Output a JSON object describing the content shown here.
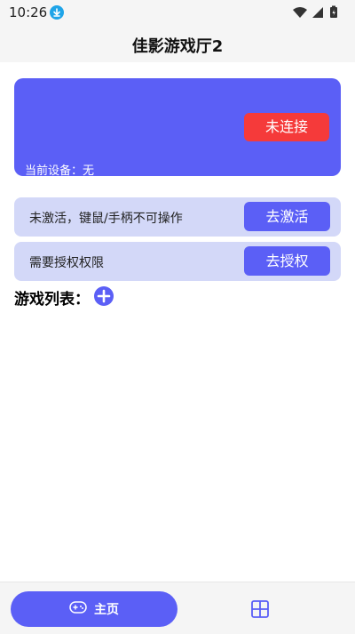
{
  "status_bar": {
    "time": "10:26"
  },
  "app_bar": {
    "title": "佳影游戏厅2"
  },
  "device_card": {
    "connect_button_label": "未连接",
    "current_device_text": "当前设备：无"
  },
  "activation_row": {
    "text": "未激活，键鼠/手柄不可操作",
    "button_label": "去激活"
  },
  "permission_row": {
    "text": "需要授权权限",
    "button_label": "去授权"
  },
  "games": {
    "title": "游戏列表："
  },
  "bottom_nav": {
    "home_label": "主页"
  },
  "colors": {
    "accent": "#5b5ff6",
    "danger": "#f53a3a",
    "row_bg": "#d3d8f8"
  },
  "icons": [
    "download-icon",
    "wifi-icon",
    "signal-icon",
    "battery-icon",
    "add-icon",
    "gamepad-icon",
    "grid-icon"
  ]
}
